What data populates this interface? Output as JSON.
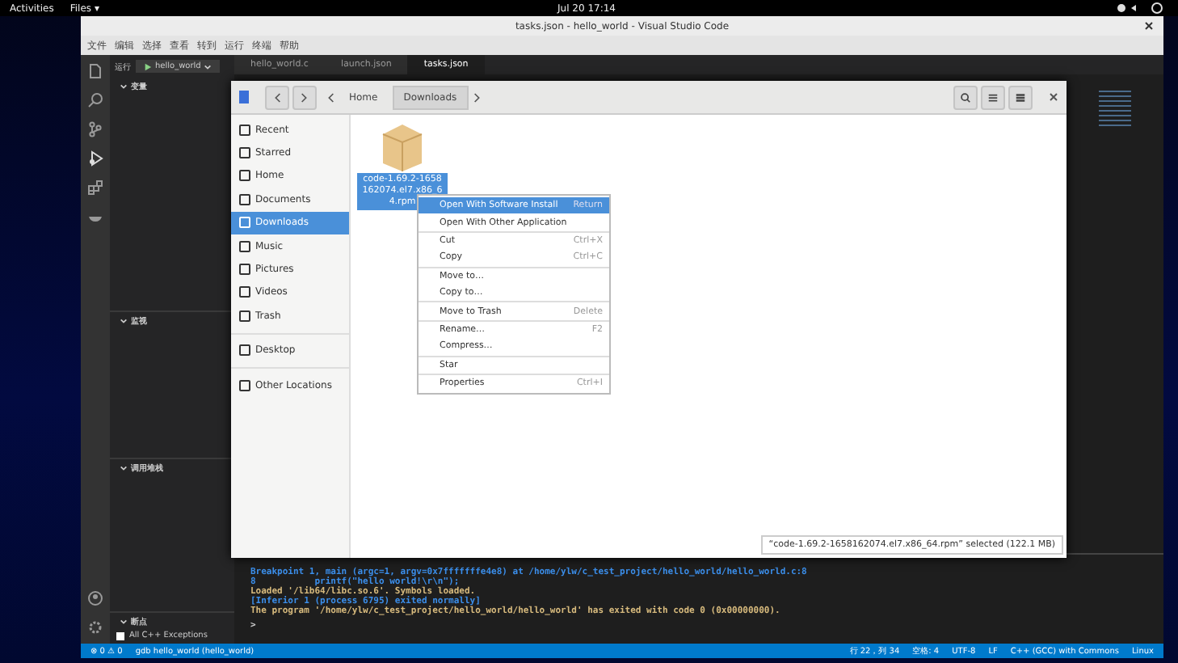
{
  "top_bar": {
    "activities": "Activities",
    "app_menu": "Files ▾",
    "clock": "Jul 20  17:14"
  },
  "vscode": {
    "title": "tasks.json - hello_world - Visual Studio Code",
    "menu": [
      "文件",
      "编辑",
      "选择",
      "查看",
      "转到",
      "运行",
      "终端",
      "帮助"
    ],
    "run_label": "运行",
    "config": "hello_world",
    "tabs": [
      {
        "label": "hello_world.c",
        "selected": false
      },
      {
        "label": "launch.json",
        "selected": false
      },
      {
        "label": "tasks.json",
        "selected": true
      }
    ],
    "sections": [
      "变量",
      "监视",
      "调用堆栈"
    ],
    "breakpoints": {
      "title": "断点",
      "items": [
        {
          "label": "All C++ Exceptions",
          "checked": false
        }
      ]
    },
    "terminal": [
      {
        "text": "Breakpoint 1, main (argc=1, argv=0x7fffffffe4e8) at /home/ylw/c_test_project/hello_world/hello_world.c:8",
        "color": "#3b8eea"
      },
      {
        "text": "8           printf(\"hello world!\\r\\n\");",
        "color": "#3b8eea"
      },
      {
        "text": "Loaded '/lib64/libc.so.6'. Symbols loaded.",
        "color": "#d7ba7d"
      },
      {
        "text": "[Inferior 1 (process 6795) exited normally]",
        "color": "#3b8eea"
      },
      {
        "text": "The program '/home/ylw/c_test_project/hello_world/hello_world' has exited with code 0 (0x00000000).",
        "color": "#d7ba7d"
      }
    ],
    "prompt": ">",
    "status_left": [
      "⊗ 0 ⚠ 0",
      "gdb hello_world (hello_world)"
    ],
    "status_right": [
      "行 22，列 34",
      "空格: 4",
      "UTF-8",
      "LF",
      "C++ (GCC) with Commons",
      "Linux"
    ]
  },
  "files": {
    "path": [
      {
        "label": "Home",
        "selected": false
      },
      {
        "label": "Downloads",
        "selected": true
      }
    ],
    "sidebar": [
      {
        "label": "Recent",
        "selected": false
      },
      {
        "label": "Starred",
        "selected": false
      },
      {
        "label": "Home",
        "selected": false
      },
      {
        "label": "Documents",
        "selected": false
      },
      {
        "label": "Downloads",
        "selected": true
      },
      {
        "label": "Music",
        "selected": false
      },
      {
        "label": "Pictures",
        "selected": false
      },
      {
        "label": "Videos",
        "selected": false
      },
      {
        "label": "Trash",
        "selected": false
      },
      {
        "label": "Desktop",
        "selected": false
      },
      {
        "label": "Other Locations",
        "selected": false
      }
    ],
    "file": {
      "name": "code-1.69.2-1658162074.el7.x86_64.rpm",
      "selected": true
    },
    "context_menu": [
      {
        "label": "Open With Software Install",
        "shortcut": "Return",
        "selected": true
      },
      {
        "label": "Open With Other Application",
        "selected": false
      },
      {
        "label": "Cut",
        "shortcut": "Ctrl+X",
        "selected": false
      },
      {
        "label": "Copy",
        "shortcut": "Ctrl+C",
        "selected": false
      },
      {
        "label": "Move to…",
        "selected": false
      },
      {
        "label": "Copy to…",
        "selected": false
      },
      {
        "label": "Move to Trash",
        "shortcut": "Delete",
        "selected": false
      },
      {
        "label": "Rename…",
        "shortcut": "F2",
        "selected": false
      },
      {
        "label": "Compress…",
        "selected": false
      },
      {
        "label": "Star",
        "selected": false
      },
      {
        "label": "Properties",
        "shortcut": "Ctrl+I",
        "selected": false
      }
    ],
    "status": "“code-1.69.2-1658162074.el7.x86_64.rpm” selected  (122.1 MB)"
  }
}
